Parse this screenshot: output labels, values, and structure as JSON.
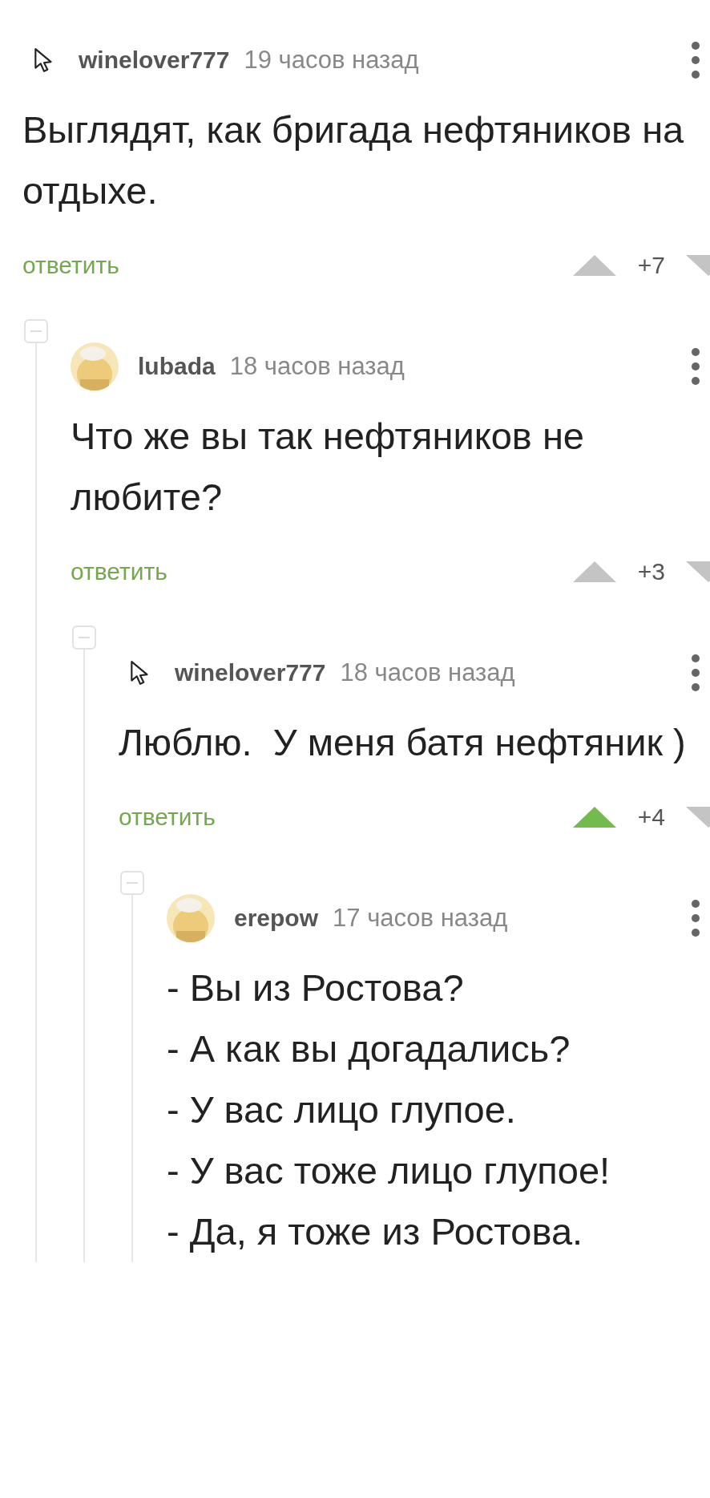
{
  "comments": [
    {
      "author": "winelover777",
      "avatar": {
        "kind": "cursor"
      },
      "time": "19 часов назад",
      "body": [
        "Выглядят, как бригада нефтяников на отдыхе."
      ],
      "reply": "ответить",
      "score": "+7",
      "voted_up": false,
      "children": [
        {
          "author": "lubada",
          "time": "18 часов назад",
          "body": [
            "Что же вы так нефтяников не любите?"
          ],
          "reply": "ответить",
          "score": "+3",
          "voted_up": false,
          "children": [
            {
              "author": "winelover777",
              "avatar": {
                "kind": "cursor"
              },
              "time": "18 часов назад",
              "body": [
                "Люблю.  У меня батя нефтяник )"
              ],
              "reply": "ответить",
              "score": "+4",
              "voted_up": true,
              "children": [
                {
                  "author": "erepow",
                  "time": "17 часов назад",
                  "body": [
                    "- Вы из Ростова?",
                    "- А как вы догадались?",
                    "- У вас лицо глупое.",
                    "- У вас тоже лицо глупое!",
                    "- Да, я тоже из Ростова."
                  ]
                }
              ]
            }
          ]
        }
      ]
    }
  ]
}
